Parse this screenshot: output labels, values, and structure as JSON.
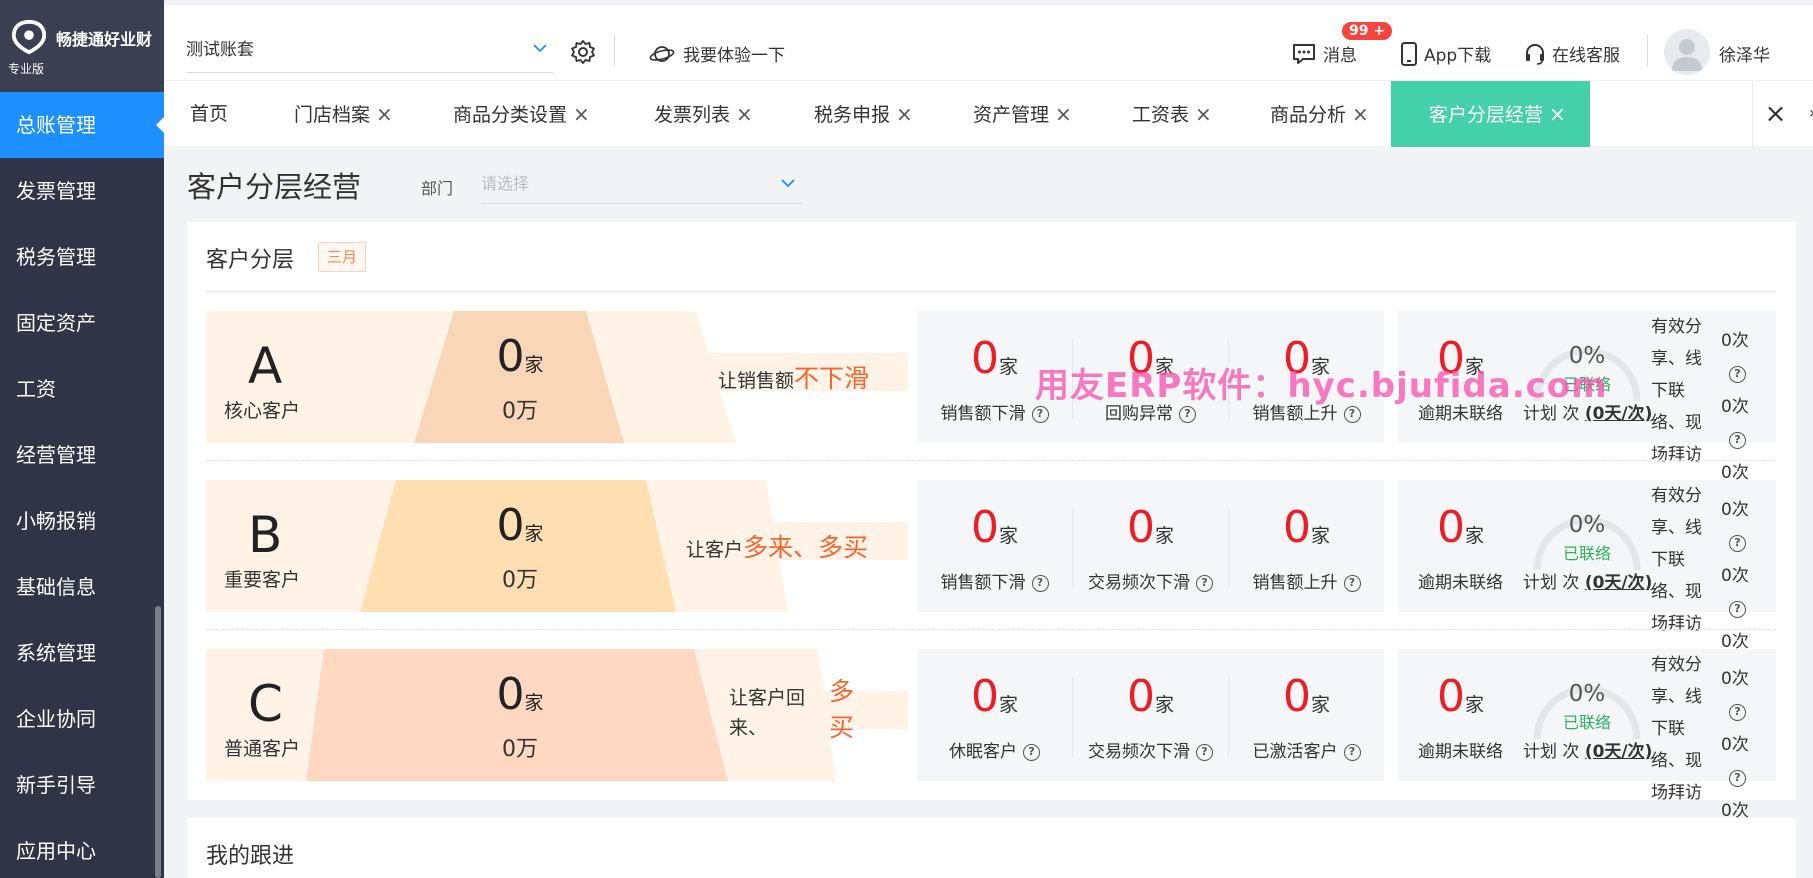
{
  "app": {
    "brand": "畅捷通好业财",
    "edition": "专业版"
  },
  "sidebar": {
    "items": [
      {
        "label": "总账管理",
        "active": true
      },
      {
        "label": "发票管理"
      },
      {
        "label": "税务管理"
      },
      {
        "label": "固定资产"
      },
      {
        "label": "工资"
      },
      {
        "label": "经营管理"
      },
      {
        "label": "小畅报销"
      },
      {
        "label": "基础信息"
      },
      {
        "label": "系统管理"
      },
      {
        "label": "企业协同"
      },
      {
        "label": "新手引导"
      },
      {
        "label": "应用中心"
      }
    ]
  },
  "topbar": {
    "account": "测试账套",
    "try_label": "我要体验一下",
    "messages_label": "消息",
    "messages_badge": "99 +",
    "app_download": "App下载",
    "online_service": "在线客服",
    "user_name": "徐泽华"
  },
  "tabs": [
    {
      "label": "首页",
      "closable": false
    },
    {
      "label": "门店档案",
      "closable": true
    },
    {
      "label": "商品分类设置",
      "closable": true
    },
    {
      "label": "发票列表",
      "closable": true
    },
    {
      "label": "税务申报",
      "closable": true
    },
    {
      "label": "资产管理",
      "closable": true
    },
    {
      "label": "工资表",
      "closable": true
    },
    {
      "label": "商品分析",
      "closable": true
    },
    {
      "label": "客户分层经营",
      "closable": true,
      "active": true
    }
  ],
  "page": {
    "title": "客户分层经营",
    "dept_label": "部门",
    "dept_placeholder": "请选择"
  },
  "segments": {
    "title": "客户分层",
    "month_tag": "三月",
    "rows": [
      {
        "letter": "A",
        "name": "核心客户",
        "count": "0",
        "count_unit": "家",
        "amount": "0万",
        "slogan_prefix": "让销售额",
        "slogan_highlight": "不下滑",
        "metrics": [
          {
            "value": "0",
            "unit": "家",
            "label": "销售额下滑"
          },
          {
            "value": "0",
            "unit": "家",
            "label": "回购异常"
          },
          {
            "value": "0",
            "unit": "家",
            "label": "销售额上升"
          }
        ],
        "contact": {
          "value": "0",
          "unit": "家",
          "label": "逾期未联络",
          "percent": "0%",
          "status": "已联络",
          "plan_prefix": "计划 次",
          "plan_value": "(0天/次)",
          "side_labels": "有效分享、线下联络、现场拜访",
          "side_values": [
            "0次",
            "0次",
            "0次"
          ]
        }
      },
      {
        "letter": "B",
        "name": "重要客户",
        "count": "0",
        "count_unit": "家",
        "amount": "0万",
        "slogan_prefix": "让客户",
        "slogan_highlight": "多来、多买",
        "metrics": [
          {
            "value": "0",
            "unit": "家",
            "label": "销售额下滑"
          },
          {
            "value": "0",
            "unit": "家",
            "label": "交易频次下滑"
          },
          {
            "value": "0",
            "unit": "家",
            "label": "销售额上升"
          }
        ],
        "contact": {
          "value": "0",
          "unit": "家",
          "label": "逾期未联络",
          "percent": "0%",
          "status": "已联络",
          "plan_prefix": "计划 次",
          "plan_value": "(0天/次)",
          "side_labels": "有效分享、线下联络、现场拜访",
          "side_values": [
            "0次",
            "0次",
            "0次"
          ]
        }
      },
      {
        "letter": "C",
        "name": "普通客户",
        "count": "0",
        "count_unit": "家",
        "amount": "0万",
        "slogan_prefix": "让客户回来、",
        "slogan_highlight": "多买",
        "metrics": [
          {
            "value": "0",
            "unit": "家",
            "label": "休眠客户"
          },
          {
            "value": "0",
            "unit": "家",
            "label": "交易频次下滑"
          },
          {
            "value": "0",
            "unit": "家",
            "label": "已激活客户"
          }
        ],
        "contact": {
          "value": "0",
          "unit": "家",
          "label": "逾期未联络",
          "percent": "0%",
          "status": "已联络",
          "plan_prefix": "计划 次",
          "plan_value": "(0天/次)",
          "side_labels": "有效分享、线下联络、现场拜访",
          "side_values": [
            "0次",
            "0次",
            "0次"
          ]
        }
      }
    ]
  },
  "watermark": "用友ERP软件：hyc.bjufida.com",
  "followup": {
    "title": "我的跟进"
  },
  "colors": {
    "accent": "#1e8fff",
    "active_tab": "#44d1a9",
    "alert_red": "#ee1d23",
    "highlight_orange": "#f5662d",
    "success_green": "#2cb35c"
  }
}
